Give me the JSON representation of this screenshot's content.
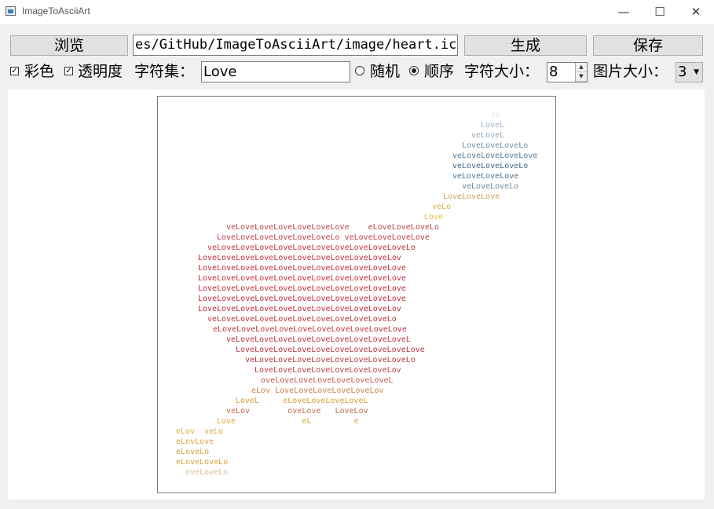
{
  "window": {
    "title": "ImageToAsciiArt",
    "minimize": "—",
    "maximize": "☐",
    "close": "✕",
    "icon": "app-window-icon"
  },
  "toolbar": {
    "browse_label": "浏览",
    "path_value": "es/GitHub/ImageToAsciiArt/image/heart.ico",
    "generate_label": "生成",
    "save_label": "保存"
  },
  "options": {
    "color_label": "彩色",
    "color_checked": true,
    "transparency_label": "透明度",
    "transparency_checked": true,
    "charset_label": "字符集：",
    "charset_value": "Love",
    "random_label": "随机",
    "random_selected": false,
    "order_label": "顺序",
    "order_selected": true,
    "char_size_label": "字符大小：",
    "char_size_value": "8",
    "image_size_label": "图片大小：",
    "image_size_value": "3"
  },
  "ascii_art": {
    "lines": [
      {
        "text": "ve",
        "color": "#dfe6ee"
      },
      {
        "text": "LoveL",
        "color": "#9fb4c8"
      },
      {
        "text": "veLoveL",
        "color": "#8ea7bd"
      },
      {
        "text": "LoveLoveLoveLo",
        "color": "#6f8ca6"
      },
      {
        "text": "veLoveLoveLoveLove",
        "color": "#567a98"
      },
      {
        "text": "veLoveLoveLoveLo",
        "color": "#3f668a"
      },
      {
        "text": "veLoveLoveLove",
        "color": "#4f7492"
      },
      {
        "text": "veLoveLoveLo",
        "color": "#6c8aa3"
      },
      {
        "text": "LoveLoveLove",
        "color": "#c9a35a"
      },
      {
        "text": "veLo",
        "color": "#e0b54a"
      },
      {
        "text": "Love",
        "color": "#e6bb3d"
      },
      {
        "text": "veLoveLoveLoveLoveLoveLove    eLoveLoveLoveLo",
        "color": "#b84343"
      },
      {
        "text": "LoveLoveLoveLoveLoveLoveLo veLoveLoveLoveLove",
        "color": "#c0394a"
      },
      {
        "text": "veLoveLoveLoveLoveLoveLoveLoveLoveLoveLoveLo",
        "color": "#c03240"
      },
      {
        "text": "LoveLoveLoveLoveLoveLoveLoveLoveLoveLoveLov",
        "color": "#c52f3e"
      },
      {
        "text": "LoveLoveLoveLoveLoveLoveLoveLoveLoveLoveLove",
        "color": "#c82c3b"
      },
      {
        "text": "LoveLoveLoveLoveLoveLoveLoveLoveLoveLoveLove",
        "color": "#ca2a39"
      },
      {
        "text": "LoveLoveLoveLoveLoveLoveLoveLoveLoveLoveLove",
        "color": "#c92938"
      },
      {
        "text": "LoveLoveLoveLoveLoveLoveLoveLoveLoveLoveLove",
        "color": "#c82a39"
      },
      {
        "text": "LoveLoveLoveLoveLoveLoveLoveLoveLoveLoveLov",
        "color": "#c52c3b"
      },
      {
        "text": "veLoveLoveLoveLoveLoveLoveLoveLoveLoveLo",
        "color": "#c22e3d"
      },
      {
        "text": "eLoveLoveLoveLoveLoveLoveLoveLoveLoveLove",
        "color": "#c0303f"
      },
      {
        "text": "veLoveLoveLoveLoveLoveLoveLoveLoveLoveL",
        "color": "#bd3241"
      },
      {
        "text": "LoveLoveLoveLoveLoveLoveLoveLoveLoveLove",
        "color": "#bb3443"
      },
      {
        "text": "veLoveLoveLoveLoveLoveLoveLoveLoveLo",
        "color": "#b93644"
      },
      {
        "text": "LoveLoveLoveLoveLoveLoveLoveLov",
        "color": "#bd3a4a"
      },
      {
        "text": "oveLoveLoveLoveLoveLoveLoveL",
        "color": "#c5594f"
      },
      {
        "text": "eLov LoveLoveLoveLoveLoveLov",
        "color": "#cf7e45"
      },
      {
        "text": "LoveL     eLoveLoveLoveLoveL",
        "color": "#d99a3c"
      },
      {
        "text": "veLov        oveLove   LoveLov",
        "color": "#c96a50"
      },
      {
        "text": "Love              eL         e",
        "color": "#d9a63a"
      },
      {
        "text": "eLov  veLo",
        "color": "#d7aa3e"
      },
      {
        "text": "eLovLove",
        "color": "#d8aa3b"
      },
      {
        "text": "eLoveLo",
        "color": "#d6a43f"
      },
      {
        "text": "eLoveLoveLo",
        "color": "#d8a23c"
      },
      {
        "text": "oveLoveLo",
        "color": "#d9c08a"
      }
    ]
  }
}
